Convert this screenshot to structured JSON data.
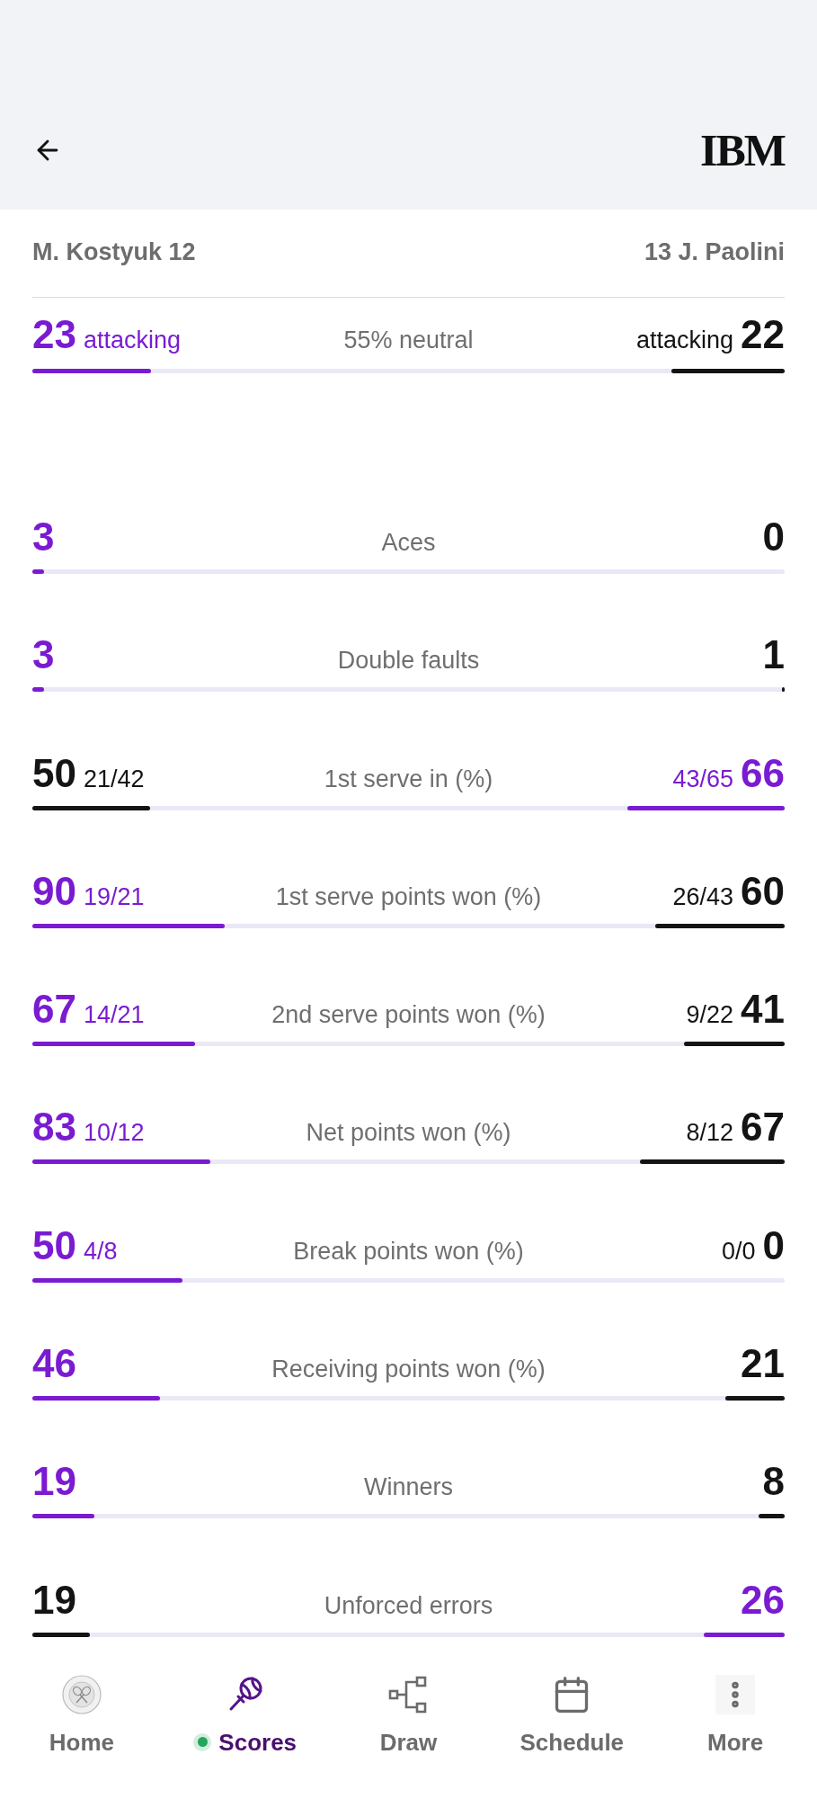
{
  "header": {
    "logo": "IBM"
  },
  "players": {
    "left": "M. Kostyuk 12",
    "right": "13 J. Paolini"
  },
  "momentum": {
    "left": {
      "value": "23",
      "label": "attacking",
      "leading": true,
      "level": 0.158
    },
    "center": "55% neutral",
    "right": {
      "value": "22",
      "label": "attacking",
      "leading": false,
      "level": 0.15
    }
  },
  "stats": [
    {
      "label": "Aces",
      "left": {
        "value": "3",
        "leading": true,
        "level": 0.015
      },
      "right": {
        "value": "0",
        "leading": false
      }
    },
    {
      "label": "Double faults",
      "left": {
        "value": "3",
        "leading": true,
        "level": 0.015
      },
      "right": {
        "value": "1",
        "leading": false,
        "level": 0.004
      }
    },
    {
      "label": "1st serve in (%)",
      "left": {
        "value": "50",
        "detail": "21/42",
        "leading": false,
        "level": 0.157
      },
      "right": {
        "value": "66",
        "detail": "43/65",
        "leading": true,
        "level": 0.209
      }
    },
    {
      "label": "1st serve points won (%)",
      "left": {
        "value": "90",
        "detail": "19/21",
        "leading": true,
        "level": 0.256
      },
      "right": {
        "value": "60",
        "detail": "26/43",
        "leading": false,
        "level": 0.172
      }
    },
    {
      "label": "2nd serve points won (%)",
      "left": {
        "value": "67",
        "detail": "14/21",
        "leading": true,
        "level": 0.216
      },
      "right": {
        "value": "41",
        "detail": "9/22",
        "leading": false,
        "level": 0.134
      }
    },
    {
      "label": "Net points won (%)",
      "left": {
        "value": "83",
        "detail": "10/12",
        "leading": true,
        "level": 0.236
      },
      "right": {
        "value": "67",
        "detail": "8/12",
        "leading": false,
        "level": 0.192
      }
    },
    {
      "label": "Break points won (%)",
      "left": {
        "value": "50",
        "detail": "4/8",
        "leading": true,
        "level": 0.2
      },
      "right": {
        "value": "0",
        "detail": "0/0",
        "leading": false
      }
    },
    {
      "label": "Receiving points won (%)",
      "left": {
        "value": "46",
        "leading": true,
        "level": 0.17
      },
      "right": {
        "value": "21",
        "leading": false,
        "level": 0.079
      }
    },
    {
      "label": "Winners",
      "left": {
        "value": "19",
        "leading": true,
        "level": 0.082
      },
      "right": {
        "value": "8",
        "leading": false,
        "level": 0.035
      }
    },
    {
      "label": "Unforced errors",
      "left": {
        "value": "19",
        "leading": false,
        "level": 0.076
      },
      "right": {
        "value": "26",
        "leading": true,
        "level": 0.107
      }
    }
  ],
  "nav": [
    {
      "label": "Home",
      "selected": false,
      "live": false
    },
    {
      "label": "Scores",
      "selected": true,
      "live": true
    },
    {
      "label": "Draw",
      "selected": false,
      "live": false
    },
    {
      "label": "Schedule",
      "selected": false,
      "live": false
    },
    {
      "label": "More",
      "selected": false,
      "live": false
    }
  ]
}
